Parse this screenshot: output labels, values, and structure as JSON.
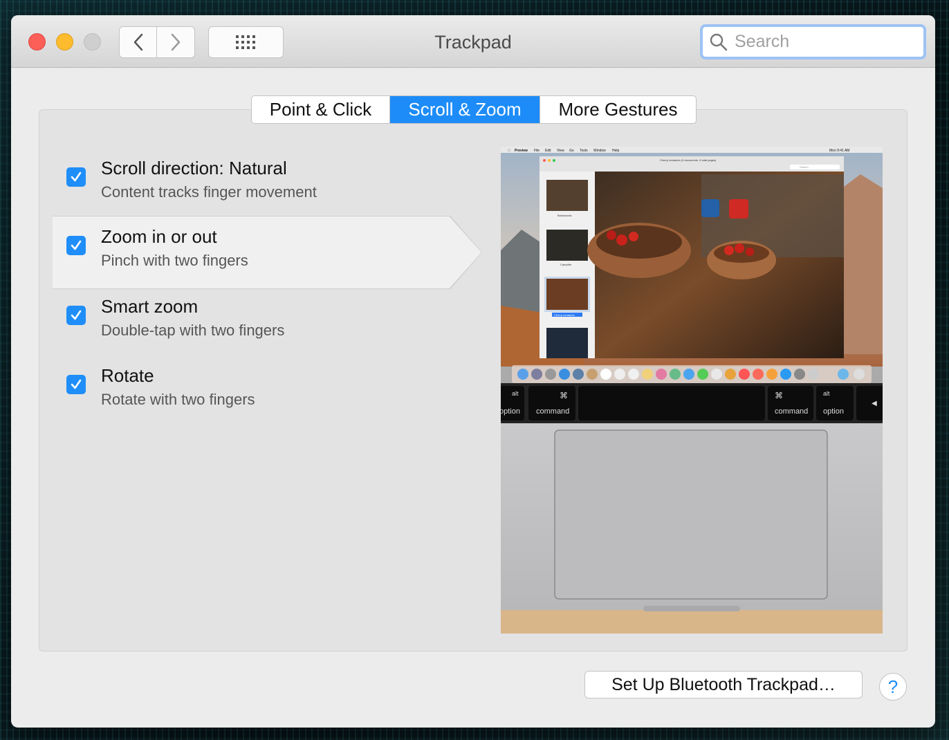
{
  "window": {
    "title": "Trackpad"
  },
  "search": {
    "placeholder": "Search"
  },
  "tabs": [
    {
      "label": "Point & Click",
      "selected": false
    },
    {
      "label": "Scroll & Zoom",
      "selected": true
    },
    {
      "label": "More Gestures",
      "selected": false
    }
  ],
  "options": [
    {
      "title": "Scroll direction: Natural",
      "subtitle": "Content tracks finger movement",
      "checked": true
    },
    {
      "title": "Zoom in or out",
      "subtitle": "Pinch with two fingers",
      "checked": true
    },
    {
      "title": "Smart zoom",
      "subtitle": "Double-tap with two fingers",
      "checked": true
    },
    {
      "title": "Rotate",
      "subtitle": "Rotate with two fingers",
      "checked": true
    }
  ],
  "preview": {
    "menubar": [
      "Preview",
      "File",
      "Edit",
      "View",
      "Go",
      "Tools",
      "Window",
      "Help"
    ],
    "clock": "Mon 9:41 AM",
    "doc_title": "Cherry tomatoes (4 documents, 4 total pages)",
    "search_placeholder": "Search",
    "thumbs": [
      "Backwoods",
      "Campfire",
      "Cherry tomatoes"
    ],
    "keys": {
      "left_option": "option",
      "left_cmd_symbol": "⌘",
      "left_cmd": "command",
      "right_cmd_symbol": "⌘",
      "right_cmd": "command",
      "right_alt": "alt",
      "right_option": "option",
      "left_alt": "alt",
      "arrow": "◀"
    }
  },
  "bottom": {
    "setup_button": "Set Up Bluetooth Trackpad…",
    "help": "?"
  }
}
